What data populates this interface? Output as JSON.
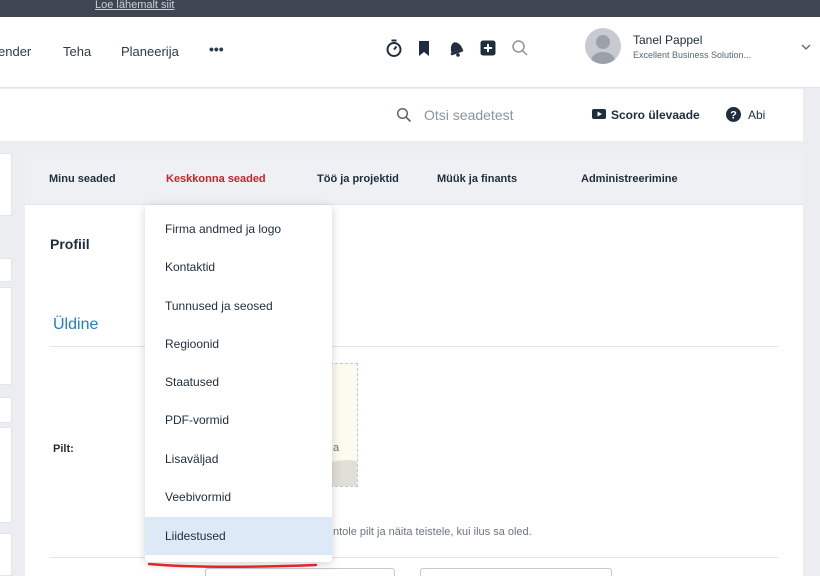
{
  "topstrip": {
    "faint_text": "...",
    "link_text": "Loe lähemalt siit"
  },
  "nav": {
    "items": [
      "ender",
      "Teha",
      "Planeerija",
      "•••"
    ],
    "user": {
      "name": "Tanel Pappel",
      "company": "Excellent Business Solution..."
    }
  },
  "settings_header": {
    "search_placeholder": "Otsi seadetest",
    "overview_label": "Scoro ülevaade",
    "help_label": "Abi"
  },
  "tabs": [
    {
      "label": "Minu seaded",
      "active": false
    },
    {
      "label": "Keskkonna seaded",
      "active": true
    },
    {
      "label": "Töö ja projektid",
      "active": false
    },
    {
      "label": "Müük ja finants",
      "active": false
    },
    {
      "label": "Administreerimine",
      "active": false
    }
  ],
  "content": {
    "profile_title": "Profiil",
    "section_title": "Üldine",
    "picture_label": "Pilt:",
    "image_text_fragment": "a",
    "help_text": "ntole pilt ja näita teistele, kui ilus sa oled."
  },
  "dropdown": {
    "items": [
      "Firma andmed ja logo",
      "Kontaktid",
      "Tunnused ja seosed",
      "Regioonid",
      "Staatused",
      "PDF-vormid",
      "Lisaväljad",
      "Veebivormid",
      "Liidestused"
    ],
    "highlighted_index": 8
  },
  "colors": {
    "active_tab": "#c8232c",
    "section_title": "#1f7fc4",
    "highlight": "#dde9f6",
    "underline_annotation": "#e0262a"
  }
}
